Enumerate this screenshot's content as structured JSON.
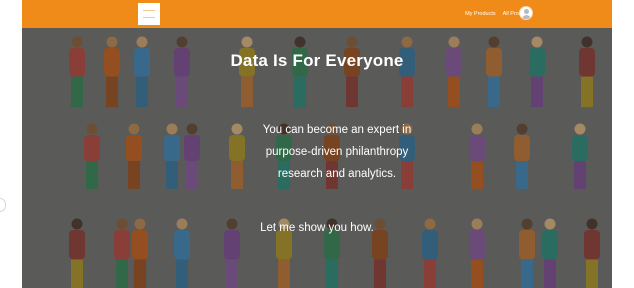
{
  "header": {
    "brand_color": "#f08a18",
    "logo_icon": "logo-icon",
    "nav": [
      "My Products",
      "All Products"
    ],
    "account_icon": "user-avatar-icon"
  },
  "hero": {
    "title": "Data Is For Everyone",
    "body_lines": [
      "You can become an expert in",
      "purpose-driven philanthropy",
      "research and analytics."
    ],
    "cta": "Let me show you how."
  },
  "background": {
    "image": "illustrated-crowd-of-diverse-people",
    "overlay_color": "#6b6b69"
  }
}
